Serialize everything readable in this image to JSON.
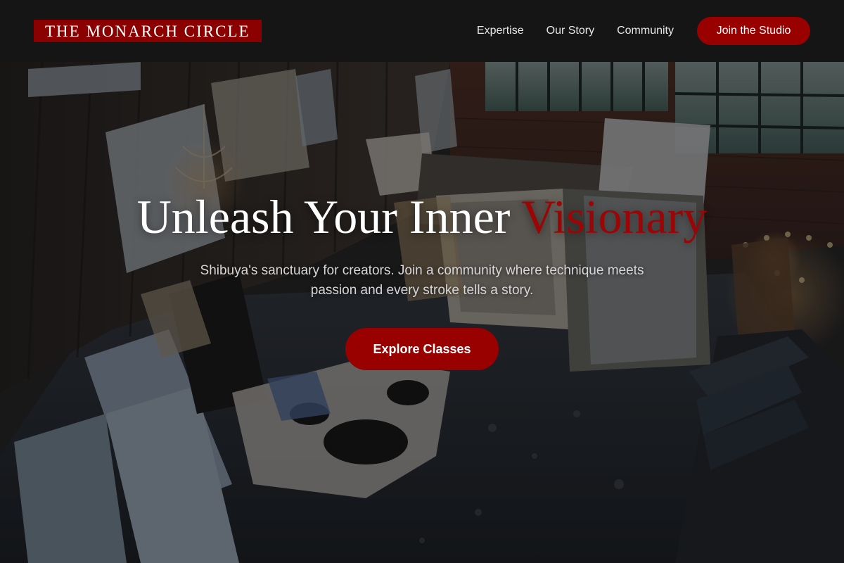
{
  "header": {
    "logo_text": "THE MONARCH CIRCLE",
    "nav": [
      {
        "label": "Expertise"
      },
      {
        "label": "Our Story"
      },
      {
        "label": "Community"
      }
    ],
    "cta_label": "Join the Studio"
  },
  "hero": {
    "title_main": "Unleash Your Inner ",
    "title_accent": "Visionary",
    "subtitle": "Shibuya's sanctuary for creators. Join a community where technique meets passion and every stroke tells a story.",
    "cta_label": "Explore Classes",
    "background": "art studio loft with leaning canvases, chandeliers and large windows"
  },
  "colors": {
    "accent": "#990000",
    "header_bg": "#151515",
    "title_accent": "#9b0505"
  }
}
